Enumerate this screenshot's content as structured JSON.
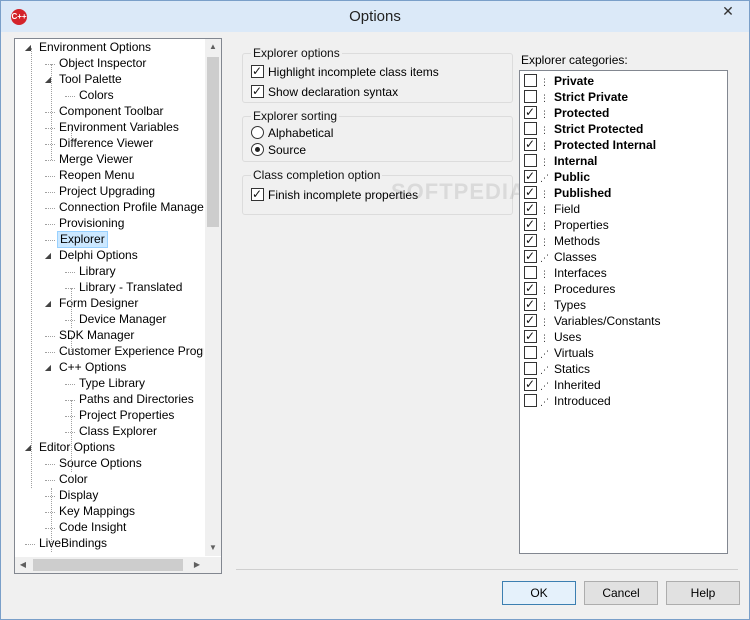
{
  "window": {
    "title": "Options",
    "app_icon": "C++"
  },
  "tree": {
    "items": [
      {
        "label": "Environment Options",
        "level": 0,
        "expander": "open"
      },
      {
        "label": "Object Inspector",
        "level": 1
      },
      {
        "label": "Tool Palette",
        "level": 1,
        "expander": "open"
      },
      {
        "label": "Colors",
        "level": 2
      },
      {
        "label": "Component Toolbar",
        "level": 1
      },
      {
        "label": "Environment Variables",
        "level": 1
      },
      {
        "label": "Difference Viewer",
        "level": 1
      },
      {
        "label": "Merge Viewer",
        "level": 1
      },
      {
        "label": "Reopen Menu",
        "level": 1
      },
      {
        "label": "Project Upgrading",
        "level": 1
      },
      {
        "label": "Connection Profile Manager",
        "level": 1
      },
      {
        "label": "Provisioning",
        "level": 1
      },
      {
        "label": "Explorer",
        "level": 1,
        "selected": true
      },
      {
        "label": "Delphi Options",
        "level": 1,
        "expander": "open"
      },
      {
        "label": "Library",
        "level": 2
      },
      {
        "label": "Library - Translated",
        "level": 2
      },
      {
        "label": "Form Designer",
        "level": 1,
        "expander": "open"
      },
      {
        "label": "Device Manager",
        "level": 2
      },
      {
        "label": "SDK Manager",
        "level": 1
      },
      {
        "label": "Customer Experience Program",
        "level": 1
      },
      {
        "label": "C++ Options",
        "level": 1,
        "expander": "open"
      },
      {
        "label": "Type Library",
        "level": 2
      },
      {
        "label": "Paths and Directories",
        "level": 2
      },
      {
        "label": "Project Properties",
        "level": 2
      },
      {
        "label": "Class Explorer",
        "level": 2
      },
      {
        "label": "Editor Options",
        "level": 0,
        "expander": "open"
      },
      {
        "label": "Source Options",
        "level": 1
      },
      {
        "label": "Color",
        "level": 1
      },
      {
        "label": "Display",
        "level": 1
      },
      {
        "label": "Key Mappings",
        "level": 1
      },
      {
        "label": "Code Insight",
        "level": 1
      },
      {
        "label": "LiveBindings",
        "level": 0
      }
    ]
  },
  "explorer_options": {
    "label": "Explorer options",
    "highlight": {
      "label": "Highlight incomplete class items",
      "checked": true
    },
    "declaration": {
      "label": "Show declaration syntax",
      "checked": true
    }
  },
  "explorer_sorting": {
    "label": "Explorer sorting",
    "alphabetical": {
      "label": "Alphabetical",
      "selected": false
    },
    "source": {
      "label": "Source",
      "selected": true
    }
  },
  "class_completion": {
    "label": "Class completion option",
    "finish": {
      "label": "Finish incomplete properties",
      "checked": true
    }
  },
  "watermark": "SOFTPEDIA",
  "categories": {
    "label": "Explorer categories:",
    "items": [
      {
        "label": "Private",
        "checked": false,
        "bold": true,
        "icon": "⋮"
      },
      {
        "label": "Strict Private",
        "checked": false,
        "bold": true,
        "icon": "⋮"
      },
      {
        "label": "Protected",
        "checked": true,
        "bold": true,
        "icon": "⋮"
      },
      {
        "label": "Strict Protected",
        "checked": false,
        "bold": true,
        "icon": "⋮"
      },
      {
        "label": "Protected Internal",
        "checked": true,
        "bold": true,
        "icon": "⋮"
      },
      {
        "label": "Internal",
        "checked": false,
        "bold": true,
        "icon": "⋮"
      },
      {
        "label": "Public",
        "checked": true,
        "bold": true,
        "icon": "⋰"
      },
      {
        "label": "Published",
        "checked": true,
        "bold": true,
        "icon": "⋮"
      },
      {
        "label": "Field",
        "checked": true,
        "bold": false,
        "icon": "⋮"
      },
      {
        "label": "Properties",
        "checked": true,
        "bold": false,
        "icon": "⋮"
      },
      {
        "label": "Methods",
        "checked": true,
        "bold": false,
        "icon": "⋮"
      },
      {
        "label": "Classes",
        "checked": true,
        "bold": false,
        "icon": "⋰"
      },
      {
        "label": "Interfaces",
        "checked": false,
        "bold": false,
        "icon": "⋮"
      },
      {
        "label": "Procedures",
        "checked": true,
        "bold": false,
        "icon": "⋮"
      },
      {
        "label": "Types",
        "checked": true,
        "bold": false,
        "icon": "⋮"
      },
      {
        "label": "Variables/Constants",
        "checked": true,
        "bold": false,
        "icon": "⋮"
      },
      {
        "label": "Uses",
        "checked": true,
        "bold": false,
        "icon": "⋮"
      },
      {
        "label": "Virtuals",
        "checked": false,
        "bold": false,
        "icon": "⋰"
      },
      {
        "label": "Statics",
        "checked": false,
        "bold": false,
        "icon": "⋰"
      },
      {
        "label": "Inherited",
        "checked": true,
        "bold": false,
        "icon": "⋰"
      },
      {
        "label": "Introduced",
        "checked": false,
        "bold": false,
        "icon": "⋰"
      }
    ]
  },
  "buttons": {
    "ok": "OK",
    "cancel": "Cancel",
    "help": "Help"
  }
}
